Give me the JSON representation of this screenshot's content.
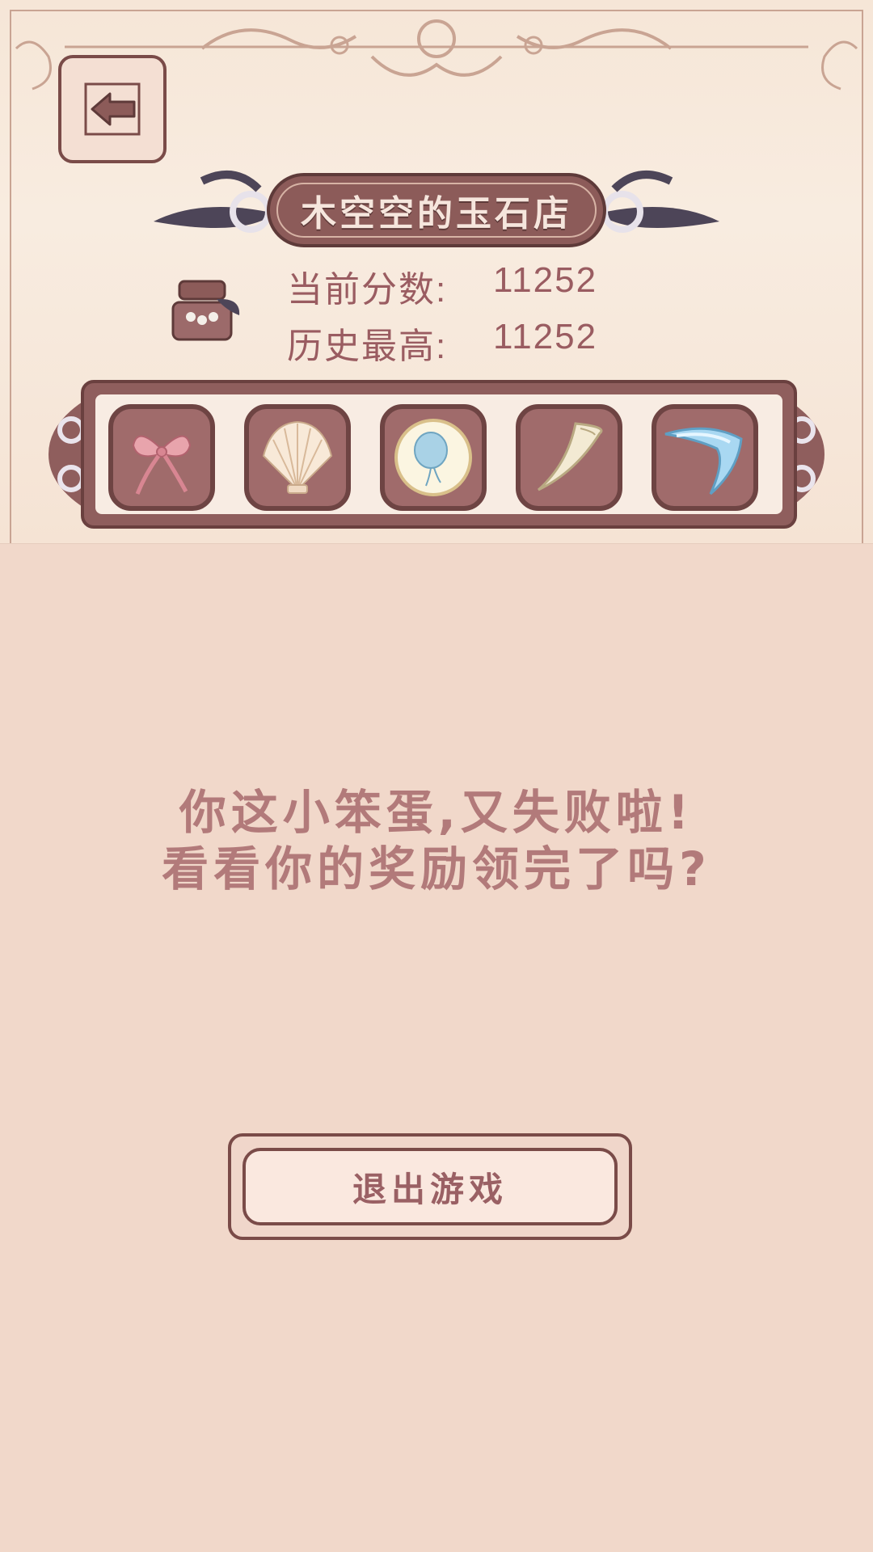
{
  "shop": {
    "title": "木空空的玉石店",
    "current_score_label": "当前分数:",
    "current_score": "11252",
    "high_score_label": "历史最高:",
    "high_score": "11252"
  },
  "items": [
    {
      "icon": "ribbon-bow-icon"
    },
    {
      "icon": "seashell-icon"
    },
    {
      "icon": "jellyfish-plate-icon"
    },
    {
      "icon": "fang-tooth-icon"
    },
    {
      "icon": "ice-boomerang-icon"
    }
  ],
  "message": {
    "line1": "你这小笨蛋,又失败啦!",
    "line2": "看看你的奖励领完了吗?"
  },
  "exit_button": {
    "label": "退出游戏"
  },
  "colors": {
    "accent": "#8c5b59",
    "background": "#f1d8ca",
    "text": "#b27a7a"
  }
}
